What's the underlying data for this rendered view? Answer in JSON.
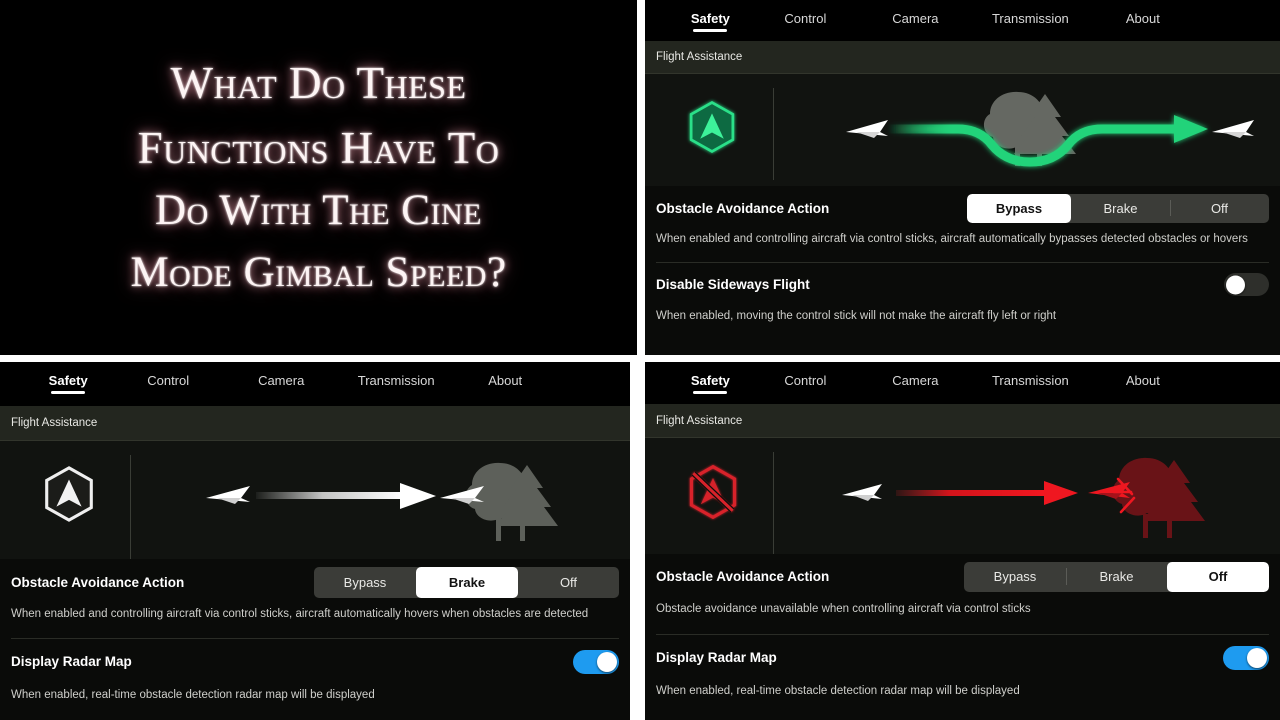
{
  "title_card": {
    "lines": [
      "What Do These",
      "Functions Have To",
      "Do With The Cine",
      "Mode Gimbal Speed?"
    ]
  },
  "tabs": [
    {
      "label": "Safety",
      "selected": true
    },
    {
      "label": "Control",
      "selected": false
    },
    {
      "label": "Camera",
      "selected": false
    },
    {
      "label": "Transmission",
      "selected": false
    },
    {
      "label": "About",
      "selected": false
    }
  ],
  "section_header": "Flight Assistance",
  "colors": {
    "accent_green": "#22d37a",
    "accent_red": "#d8232a",
    "toggle_on": "#1e9bf0",
    "selected_segment_bg": "#ffffff",
    "segment_track": "#3b3c38",
    "panel_bg": "#0a0b09",
    "header_bg": "#23261f"
  },
  "panels": {
    "bypass": {
      "icon": "hexagon-avoidance-icon",
      "icon_color": "#22d37a",
      "icon_state": "bypass",
      "illustration": "drone-bypasses-trees-green-curved-path",
      "setting_title": "Obstacle Avoidance Action",
      "segments": [
        {
          "label": "Bypass",
          "selected": true
        },
        {
          "label": "Brake",
          "selected": false
        },
        {
          "label": "Off",
          "selected": false
        }
      ],
      "description": "When enabled and controlling aircraft via control sticks, aircraft automatically bypasses detected obstacles or hovers",
      "secondary": {
        "title": "Disable Sideways Flight",
        "toggle_state": "off",
        "description": "When enabled, moving the control stick will not make the aircraft fly left or right"
      }
    },
    "brake": {
      "icon": "hexagon-avoidance-icon",
      "icon_color": "#e6e6e6",
      "icon_state": "brake",
      "illustration": "drone-stops-before-trees-white-straight-arrow",
      "setting_title": "Obstacle Avoidance Action",
      "segments": [
        {
          "label": "Bypass",
          "selected": false
        },
        {
          "label": "Brake",
          "selected": true
        },
        {
          "label": "Off",
          "selected": false
        }
      ],
      "description": "When enabled and controlling aircraft via control sticks, aircraft automatically hovers when obstacles are detected",
      "secondary": {
        "title": "Display Radar Map",
        "toggle_state": "on",
        "description": "When enabled, real-time obstacle detection radar map will be displayed"
      }
    },
    "off": {
      "icon": "hexagon-avoidance-disabled-icon",
      "icon_color": "#d8232a",
      "icon_state": "off",
      "illustration": "drone-collides-with-trees-red-straight-arrow",
      "setting_title": "Obstacle Avoidance Action",
      "segments": [
        {
          "label": "Bypass",
          "selected": false
        },
        {
          "label": "Brake",
          "selected": false
        },
        {
          "label": "Off",
          "selected": true
        }
      ],
      "description": "Obstacle avoidance unavailable when controlling aircraft via control sticks",
      "secondary": {
        "title": "Display Radar Map",
        "toggle_state": "on",
        "description": "When enabled, real-time obstacle detection radar map will be displayed"
      }
    }
  }
}
